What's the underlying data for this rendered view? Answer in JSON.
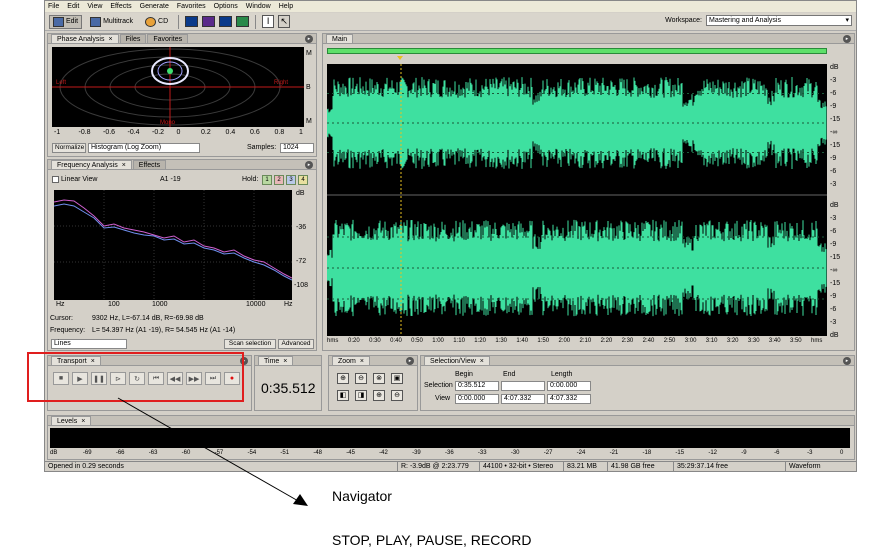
{
  "menu": [
    "File",
    "Edit",
    "View",
    "Effects",
    "Generate",
    "Favorites",
    "Options",
    "Window",
    "Help"
  ],
  "toolbar": {
    "edit": "Edit",
    "multitrack": "Multitrack",
    "cd": "CD",
    "workspace_label": "Workspace:",
    "workspace_value": "Mastering and Analysis"
  },
  "phase": {
    "tabs": [
      "Phase Analysis",
      "Files",
      "Favorites"
    ],
    "left": "Left",
    "right": "Right",
    "mono": "Mono",
    "scale_r": [
      "M",
      "B",
      "M"
    ],
    "ticks": [
      "-1",
      "-0.8",
      "-0.6",
      "-0.4",
      "-0.2",
      "0",
      "0.2",
      "0.4",
      "0.6",
      "0.8",
      "1"
    ],
    "normalize": "Normalize",
    "mode": "Histogram (Log Zoom)",
    "samples_label": "Samples:",
    "samples_value": "1024"
  },
  "freq": {
    "tabs": [
      "Frequency Analysis",
      "Effects"
    ],
    "linear": "Linear View",
    "marker": "A1 -19",
    "hold": "Hold:",
    "hold_buttons": [
      "1",
      "2",
      "3",
      "4"
    ],
    "db_ticks": [
      "dB",
      "-36",
      "-72",
      "-108"
    ],
    "hz_ticks": [
      "Hz",
      "100",
      "1000",
      "10000",
      "Hz"
    ],
    "cursor_label": "Cursor:",
    "cursor_value": "9302 Hz, L=-67.14 dB, R=-69.98 dB",
    "freq_label": "Frequency:",
    "freq_value": "L= 54.397 Hz (A1 -19), R= 54.545 Hz (A1 -14)",
    "lines": "Lines",
    "scan": "Scan selection",
    "advanced": "Advanced"
  },
  "main": {
    "tab": "Main",
    "db_top": [
      "dB",
      "-3",
      "-6",
      "-9",
      "-15",
      "-∞",
      "-15",
      "-9",
      "-6",
      "-3"
    ],
    "db_bot": [
      "dB",
      "-3",
      "-6",
      "-9",
      "-15",
      "-∞",
      "-15",
      "-9",
      "-6",
      "-3",
      "dB"
    ],
    "time_ticks": [
      "hms",
      "0:20",
      "0:30",
      "0:40",
      "0:50",
      "1:00",
      "1:10",
      "1:20",
      "1:30",
      "1:40",
      "1:50",
      "2:00",
      "2:10",
      "2:20",
      "2:30",
      "2:40",
      "2:50",
      "3:00",
      "3:10",
      "3:20",
      "3:30",
      "3:40",
      "3:50",
      "hms"
    ],
    "wave_color": "#3ee0a0"
  },
  "transport": {
    "tab": "Transport",
    "buttons": [
      "stop",
      "play",
      "pause",
      "play-from",
      "loop",
      "go-start",
      "rewind",
      "forward",
      "go-end",
      "record"
    ]
  },
  "time": {
    "tab": "Time",
    "value": "0:35.512"
  },
  "zoom": {
    "tab": "Zoom"
  },
  "selection": {
    "tab": "Selection/View",
    "headers": [
      "Begin",
      "End",
      "Length"
    ],
    "rows": [
      {
        "label": "Selection",
        "begin": "0:35.512",
        "end": "",
        "length": "0:00.000"
      },
      {
        "label": "View",
        "begin": "0:00.000",
        "end": "4:07.332",
        "length": "4:07.332"
      }
    ]
  },
  "levels": {
    "tab": "Levels",
    "ticks": [
      "dB",
      "-69",
      "-66",
      "-63",
      "-60",
      "-57",
      "-54",
      "-51",
      "-48",
      "-45",
      "-42",
      "-39",
      "-36",
      "-33",
      "-30",
      "-27",
      "-24",
      "-21",
      "-18",
      "-15",
      "-12",
      "-9",
      "-6",
      "-3",
      "0"
    ]
  },
  "status": {
    "left": "Opened in 0.29 seconds",
    "r": "R: -3.9dB @ 2:23.779",
    "format": "44100 • 32-bit • Stereo",
    "size": "83.21 MB",
    "free": "41.98 GB free",
    "time_free": "35:29:37.14 free",
    "view": "Waveform"
  },
  "annotation": {
    "navigator": "Navigator",
    "caption": "STOP, PLAY, PAUSE, RECORD"
  }
}
